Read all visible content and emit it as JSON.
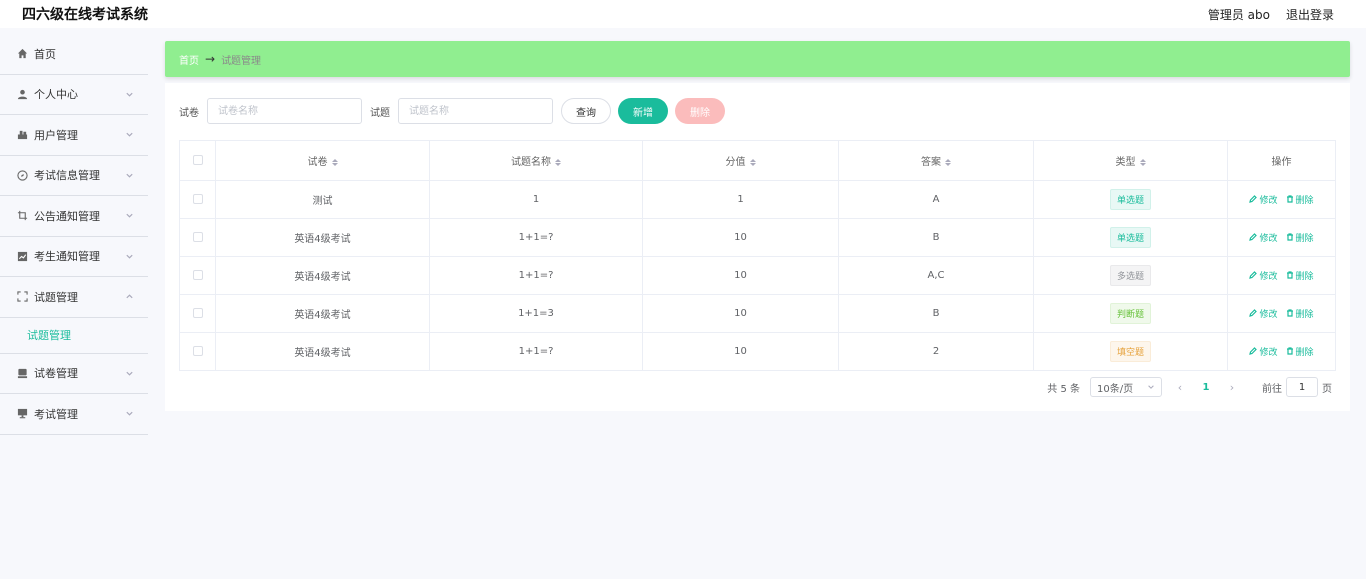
{
  "app": {
    "title": "四六级在线考试系统"
  },
  "topbar": {
    "admin_label": "管理员 abo",
    "logout_label": "退出登录"
  },
  "sidebar": {
    "items": [
      {
        "label": "首页",
        "icon": "home-icon"
      },
      {
        "label": "个人中心",
        "icon": "user-icon"
      },
      {
        "label": "用户管理",
        "icon": "users-icon"
      },
      {
        "label": "考试信息管理",
        "icon": "compass-icon"
      },
      {
        "label": "公告通知管理",
        "icon": "crop-icon"
      },
      {
        "label": "考生通知管理",
        "icon": "chart-icon"
      },
      {
        "label": "试题管理",
        "icon": "fullscreen-icon"
      },
      {
        "label": "试卷管理",
        "icon": "monitor-icon"
      },
      {
        "label": "考试管理",
        "icon": "desktop-icon"
      }
    ],
    "submenu": {
      "label": "试题管理"
    }
  },
  "breadcrumb": {
    "home": "首页",
    "arrow": "→",
    "current": "试题管理"
  },
  "search": {
    "paper_label": "试卷",
    "paper_placeholder": "试卷名称",
    "question_label": "试题",
    "question_placeholder": "试题名称",
    "query_button": "查询",
    "add_button": "新增",
    "delete_button": "删除"
  },
  "table": {
    "headers": [
      "试卷",
      "试题名称",
      "分值",
      "答案",
      "类型",
      "操作"
    ],
    "edit_label": "修改",
    "delete_label": "删除",
    "rows": [
      {
        "paper": "测试",
        "question": "1",
        "score": "1",
        "answer": "A",
        "type": "单选题",
        "tag": "green"
      },
      {
        "paper": "英语4级考试",
        "question": "1+1=?",
        "score": "10",
        "answer": "B",
        "type": "单选题",
        "tag": "green"
      },
      {
        "paper": "英语4级考试",
        "question": "1+1=?",
        "score": "10",
        "answer": "A,C",
        "type": "多选题",
        "tag": "gray"
      },
      {
        "paper": "英语4级考试",
        "question": "1+1=3",
        "score": "10",
        "answer": "B",
        "type": "判断题",
        "tag": "lime"
      },
      {
        "paper": "英语4级考试",
        "question": "1+1=?",
        "score": "10",
        "answer": "2",
        "type": "填空题",
        "tag": "orange"
      }
    ]
  },
  "pagination": {
    "total_label": "共 5 条",
    "page_size": "10条/页",
    "current_page": "1",
    "goto_label": "前往",
    "goto_value": "1",
    "page_unit": "页"
  },
  "colors": {
    "accent": "#1abc9c",
    "breadcrumb_bg": "#90ee90",
    "delete_button": "#fbbcbc"
  }
}
